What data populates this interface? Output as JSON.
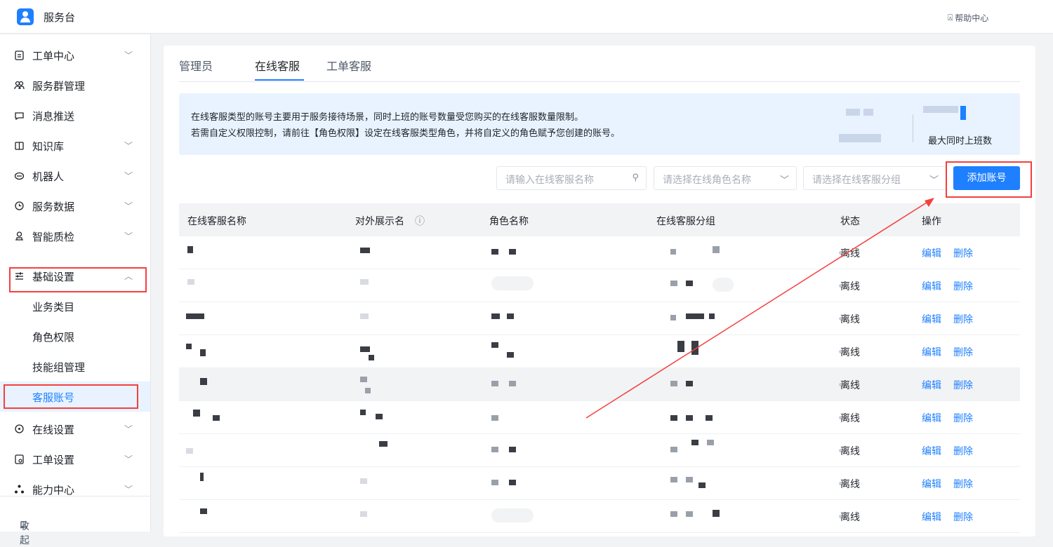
{
  "header": {
    "app_title": "服务台",
    "help_label": "帮助中心"
  },
  "sidebar": {
    "items": [
      {
        "label": "工单中心"
      },
      {
        "label": "服务群管理"
      },
      {
        "label": "消息推送"
      },
      {
        "label": "知识库"
      },
      {
        "label": "机器人"
      },
      {
        "label": "服务数据"
      },
      {
        "label": "智能质检"
      },
      {
        "label": "基础设置"
      },
      {
        "label": "在线设置"
      },
      {
        "label": "工单设置"
      },
      {
        "label": "能力中心"
      }
    ],
    "sub_items": [
      {
        "label": "业务类目"
      },
      {
        "label": "角色权限"
      },
      {
        "label": "技能组管理"
      },
      {
        "label": "客服账号"
      }
    ],
    "collapse_label": "收起"
  },
  "tabs": [
    {
      "label": "管理员"
    },
    {
      "label": "在线客服"
    },
    {
      "label": "工单客服"
    }
  ],
  "notice": {
    "line1": "在线客服类型的账号主要用于服务接待场景，同时上班的账号数量受您购买的在线客服数量限制。",
    "line2": "若需自定义权限控制，请前往【角色权限】设定在线客服类型角色，并将自定义的角色赋予您创建的账号。",
    "max_label": "最大同时上班数"
  },
  "filters": {
    "name_placeholder": "请输入在线客服名称",
    "role_placeholder": "请选择在线角色名称",
    "group_placeholder": "请选择在线客服分组"
  },
  "add_button_label": "添加账号",
  "table": {
    "headers": [
      "在线客服名称",
      "对外展示名",
      "角色名称",
      "在线客服分组",
      "状态",
      "操作"
    ],
    "rows": [
      {
        "status": "离线",
        "edit": "编辑",
        "delete": "删除"
      },
      {
        "status": "离线",
        "edit": "编辑",
        "delete": "删除"
      },
      {
        "status": "离线",
        "edit": "编辑",
        "delete": "删除"
      },
      {
        "status": "离线",
        "edit": "编辑",
        "delete": "删除"
      },
      {
        "status": "离线",
        "edit": "编辑",
        "delete": "删除"
      },
      {
        "status": "离线",
        "edit": "编辑",
        "delete": "删除"
      },
      {
        "status": "离线",
        "edit": "编辑",
        "delete": "删除"
      },
      {
        "status": "离线",
        "edit": "编辑",
        "delete": "删除"
      },
      {
        "status": "离线",
        "edit": "编辑",
        "delete": "删除"
      }
    ]
  },
  "colors": {
    "accent": "#1e80ff",
    "annotation": "#f53f3f"
  }
}
